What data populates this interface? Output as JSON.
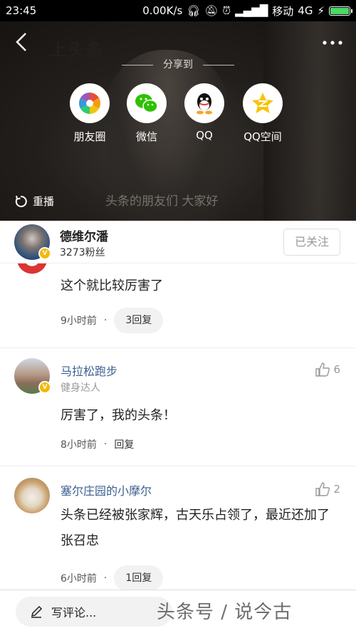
{
  "status_bar": {
    "time": "23:45",
    "network_speed": "0.00K/s",
    "carrier": "移动",
    "network_type": "4G"
  },
  "video": {
    "logo_text": "上头条",
    "share_title": "分享到",
    "share_options": [
      {
        "label": "朋友圈",
        "icon": "moments-icon"
      },
      {
        "label": "微信",
        "icon": "wechat-icon"
      },
      {
        "label": "QQ",
        "icon": "qq-icon"
      },
      {
        "label": "QQ空间",
        "icon": "qzone-icon"
      }
    ],
    "replay_label": "重播",
    "subtitle": "头条的朋友们 大家好"
  },
  "author": {
    "name": "德维尔潘",
    "fans": "3273粉丝",
    "follow_label": "已关注"
  },
  "comments": [
    {
      "text": "这个就比较厉害了",
      "time": "9小时前",
      "reply": "3回复"
    },
    {
      "name": "马拉松跑步",
      "sub": "健身达人",
      "likes": "6",
      "text": "厉害了，我的头条！",
      "time": "8小时前",
      "reply": "回复"
    },
    {
      "name": "塞尔庄园的小摩尔",
      "likes": "2",
      "text": "头条已经被张家辉，古天乐占领了，最近还加了张召忠",
      "time": "6小时前",
      "reply": "1回复"
    }
  ],
  "bottom_bar": {
    "write_placeholder": "写评论...",
    "watermark": "头条号 / 说今古"
  },
  "colors": {
    "link_name": "#3b5f8f",
    "verified_badge": "#f5b800",
    "battery_fill": "#4cd964"
  }
}
